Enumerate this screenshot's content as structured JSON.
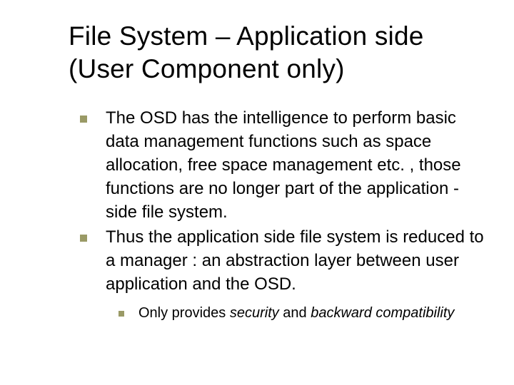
{
  "title": "File System – Application side (User Component only)",
  "bullets": [
    {
      "text": "The OSD has the intelligence to perform basic data management functions such as space allocation, free space management etc. , those functions are no longer part of the application -side file system."
    },
    {
      "text": "Thus the application side file system is reduced to a manager : an abstraction layer between user application and the OSD."
    }
  ],
  "sub": {
    "prefix": "Only provides ",
    "em1": "security",
    "mid": " and ",
    "em2": "backward compatibility"
  }
}
